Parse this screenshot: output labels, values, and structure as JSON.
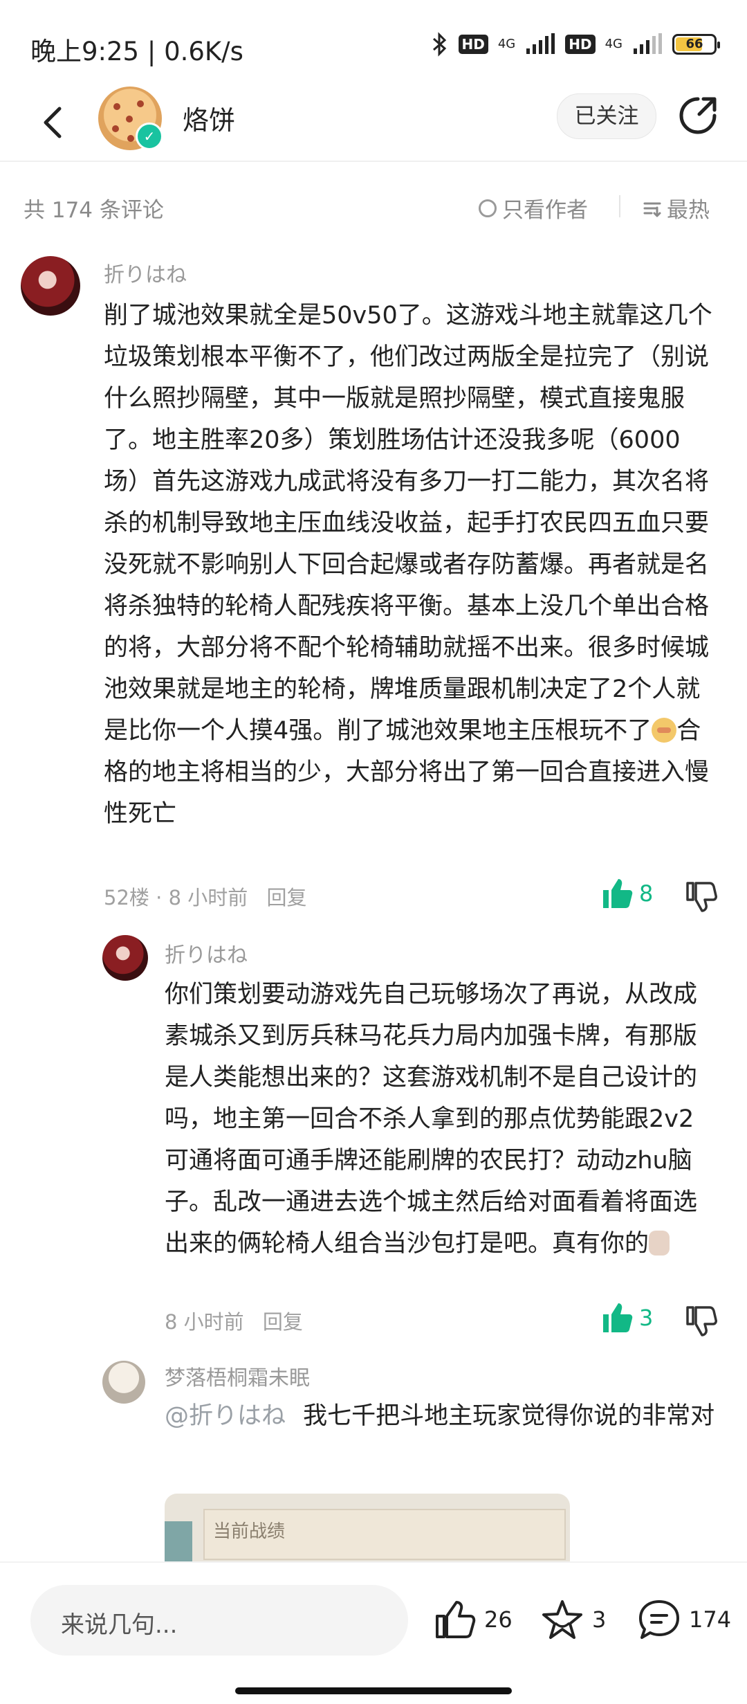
{
  "status_bar": {
    "time": "晚上9:25 | 0.6K/s",
    "hd1": "HD",
    "net1": "4G",
    "hd2": "HD",
    "net2": "4G",
    "battery": "66",
    "battery_level": 0.66
  },
  "header": {
    "author_name": "烙饼",
    "follow_label": "已关注"
  },
  "filter": {
    "comment_count": "共 174 条评论",
    "only_author_label": "只看作者",
    "sort_label": "最热"
  },
  "comments": [
    {
      "user": "折りはね",
      "text": "削了城池效果就全是50v50了。这游戏斗地主就靠这几个垃圾策划根本平衡不了，他们改过两版全是拉完了（别说什么照抄隔壁，其中一版就是照抄隔壁，模式直接鬼服了。地主胜率20多）策划胜场估计还没我多呢（6000场）首先这游戏九成武将没有多刀一打二能力，其次名将杀的机制导致地主压血线没收益，起手打农民四五血只要没死就不影响别人下回合起爆或者存防蓄爆。再者就是名将杀独特的轮椅人配残疾将平衡。基本上没几个单出合格的将，大部分将不配个轮椅辅助就摇不出来。很多时候城池效果就是地主的轮椅，牌堆质量跟机制决定了2个人就是比你一个人摸4强。削了城池效果地主压根玩不了",
      "text_tail": "合格的地主将相当的少，大部分将出了第一回合直接进入慢性死亡",
      "floor": "52楼",
      "time": "8 小时前",
      "reply_label": "回复",
      "likes": "8"
    },
    {
      "user": "折りはね",
      "text": "你们策划要动游戏先自己玩够场次了再说，从改成素城杀又到厉兵秣马花兵力局内加强卡牌，有那版是人类能想出来的？这套游戏机制不是自己设计的吗，地主第一回合不杀人拿到的那点优势能跟2v2可通将面可通手牌还能刷牌的农民打？动动zhu脑子。乱改一通进去选个城主然后给对面看着将面选出来的俩轮椅人组合当沙包打是吧。真有你的",
      "time": "8 小时前",
      "reply_label": "回复",
      "likes": "3"
    },
    {
      "user": "梦落梧桐霜未眠",
      "mention": "@折りはね",
      "text": "我七千把斗地主玩家觉得你说的非常对",
      "image_title": "当前战绩"
    }
  ],
  "bottom": {
    "input_placeholder": "来说几句...",
    "likes": "26",
    "favorites": "3",
    "comments": "174"
  },
  "colors": {
    "accent_green": "#12b886",
    "verified_teal": "#19c3a0"
  }
}
